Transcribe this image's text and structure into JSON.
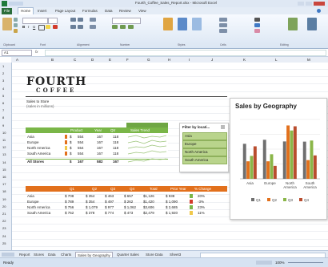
{
  "window": {
    "title": "Fourth_Coffee_Sales_Report.xlsx - Microsoft Excel"
  },
  "ribbon_tabs": [
    "File",
    "Home",
    "Insert",
    "Page Layout",
    "Formulas",
    "Data",
    "Review",
    "View"
  ],
  "ribbon_groups": [
    "Clipboard",
    "Font",
    "Alignment",
    "Number",
    "Styles",
    "Cells",
    "Editing"
  ],
  "namebox": "A1",
  "columns": [
    "A",
    "B",
    "C",
    "D",
    "E",
    "F",
    "G",
    "H",
    "I",
    "J",
    "K",
    "L",
    "M"
  ],
  "rows": [
    "1",
    "2",
    "3",
    "4",
    "5",
    "6",
    "7",
    "8",
    "9",
    "10",
    "11",
    "12",
    "13",
    "14",
    "15",
    "16",
    "17",
    "18",
    "19",
    "20",
    "21",
    "22",
    "23",
    "24",
    "25"
  ],
  "logo": {
    "line1": "FOURTH",
    "line2": "COFFEE"
  },
  "subtitle": {
    "line1": "Sales to Store",
    "line2": "(sales in millions)"
  },
  "slicer": {
    "title": "Filter by locati...",
    "items": [
      "Asia",
      "Europe",
      "North America",
      "South America"
    ]
  },
  "top_table": {
    "header": [
      "Product",
      "Year",
      "Qtr",
      "Sparkline",
      "Sales Trend"
    ],
    "rows": [
      [
        "Asia",
        "$",
        "554",
        "167",
        "118"
      ],
      [
        "Europe",
        "$",
        "554",
        "167",
        "118"
      ],
      [
        "North America",
        "$",
        "554",
        "167",
        "118"
      ],
      [
        "South America",
        "$",
        "554",
        "167",
        "118"
      ],
      [
        "All Stores",
        "$",
        "167",
        "582",
        "167"
      ]
    ]
  },
  "bottom_table": {
    "header": [
      "",
      "Q1",
      "Q2",
      "Q3",
      "Q4",
      "Total",
      "Prior Year",
      "% Change"
    ],
    "rows": [
      [
        "Asia",
        "$ 708",
        "$ 354",
        "$ 463",
        "$ 657",
        "$1,126",
        "$ 938",
        "20%"
      ],
      [
        "Europe",
        "$ 789",
        "$ 354",
        "$ 497",
        "$ 262",
        "$1,420",
        "$ 1,090",
        "-3%"
      ],
      [
        "North America",
        "$ 756",
        "$ 1,079",
        "$ 977",
        "$ 1,062",
        "$3,606",
        "$ 2,685",
        "23%"
      ],
      [
        "South America",
        "$ 752",
        "$ 378",
        "$ 774",
        "$ 473",
        "$2,479",
        "$ 1,920",
        "11%"
      ]
    ]
  },
  "chart": {
    "title": "Sales by Geography",
    "categories": [
      "Asia",
      "Europe",
      "North America",
      "South America"
    ],
    "legend": "Q1  Q2  Q3  Q4",
    "colors": [
      "#6f6f6f",
      "#e2701c",
      "#8ab648",
      "#b94d2e"
    ]
  },
  "chart_data": {
    "type": "bar",
    "title": "Sales by Geography",
    "categories": [
      "Asia",
      "Europe",
      "North America",
      "South America"
    ],
    "series": [
      {
        "name": "Q1",
        "values": [
          708,
          789,
          756,
          752
        ]
      },
      {
        "name": "Q2",
        "values": [
          354,
          354,
          1079,
          378
        ]
      },
      {
        "name": "Q3",
        "values": [
          463,
          497,
          977,
          774
        ]
      },
      {
        "name": "Q4",
        "values": [
          657,
          262,
          1062,
          473
        ]
      }
    ],
    "ylim": [
      0,
      1200
    ],
    "legend": "bottom"
  },
  "sheet_tabs": [
    "Report",
    "Stores",
    "Data",
    "Charts",
    "Sales by Geography",
    "Quarter Sales",
    "Store Data",
    "Sheet3"
  ],
  "status": {
    "text": "Ready",
    "zoom": "100%"
  },
  "accent": {
    "green": "#7ab648",
    "orange": "#e2701c",
    "dark": "#3b3b3b"
  }
}
